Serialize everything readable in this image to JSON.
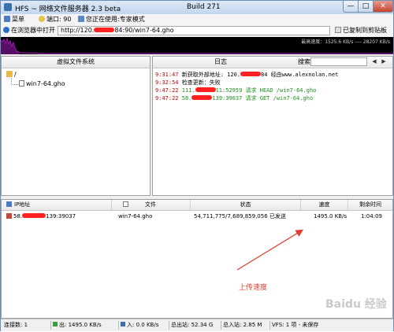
{
  "window": {
    "title": "HFS ~ 网络文件服务器 2.3 beta",
    "build": "Build 271",
    "close_glyph": "✕",
    "min_glyph": "—",
    "max_glyph": "□"
  },
  "menubar": {
    "menu": "菜单",
    "port": "端口: 90",
    "mode": "您正在使用:专家模式"
  },
  "urlbar": {
    "open_label": "在浏览器中打开",
    "url_prefix": "http://120.",
    "url_suffix": "84:90/win7-64.gho",
    "copy_label": "已复制到剪贴板"
  },
  "graph": {
    "speed_text": "最高速度：1525.6 KB/s ---- 28207 KB/s"
  },
  "vfs": {
    "title": "虚拟文件系统",
    "root": "/",
    "file": "win7-64.gho"
  },
  "log": {
    "title": "日志",
    "search_label": "搜索",
    "lines": [
      {
        "time": "9:31:47",
        "msg_a": "新获取外部地址: 120.",
        "msg_b": "84 经由www.alexnolan.net",
        "color": "#000000"
      },
      {
        "time": "9:32:54",
        "msg_a": "检查更新：失败",
        "msg_b": "",
        "color": "#000000"
      },
      {
        "time": "9:47:22",
        "msg_a": "111.",
        "msg_b": "11:52959 请求 HEAD /win7-64.gho",
        "color": "#1c8f1c"
      },
      {
        "time": "9:47:22",
        "msg_a": "58.",
        "msg_b": "139:39037 请求 GET /win7-64.gho",
        "color": "#1c8f1c"
      }
    ]
  },
  "connections": {
    "headers": {
      "ip": "IP地址",
      "file": "文件",
      "status": "状态",
      "speed": "速度",
      "remaining": "剩余时间"
    },
    "rows": [
      {
        "ip_a": "58.",
        "ip_b": "139:39037",
        "file": "win7-64.gho",
        "status": "54,711,775/7,689,859,056 已发送",
        "speed": "1495.0 KB/s",
        "remaining": "1:04:09"
      }
    ]
  },
  "annotation": "上传速度",
  "watermark": "Baidu 经验",
  "statusbar": {
    "connections": "连接数: 1",
    "out": "出: 1495.0 KB/s",
    "in": "入: 0.0 KB/s",
    "total_out": "总出站: 52.34 G",
    "total_in": "总入站: 2.85 M",
    "vfs": "VFS: 1 项 - 未保存"
  },
  "colors": {
    "log_time": "#c00000",
    "annotation": "#e03c2c",
    "redaction": "#ff2020",
    "graph_line": "#b020c8"
  }
}
